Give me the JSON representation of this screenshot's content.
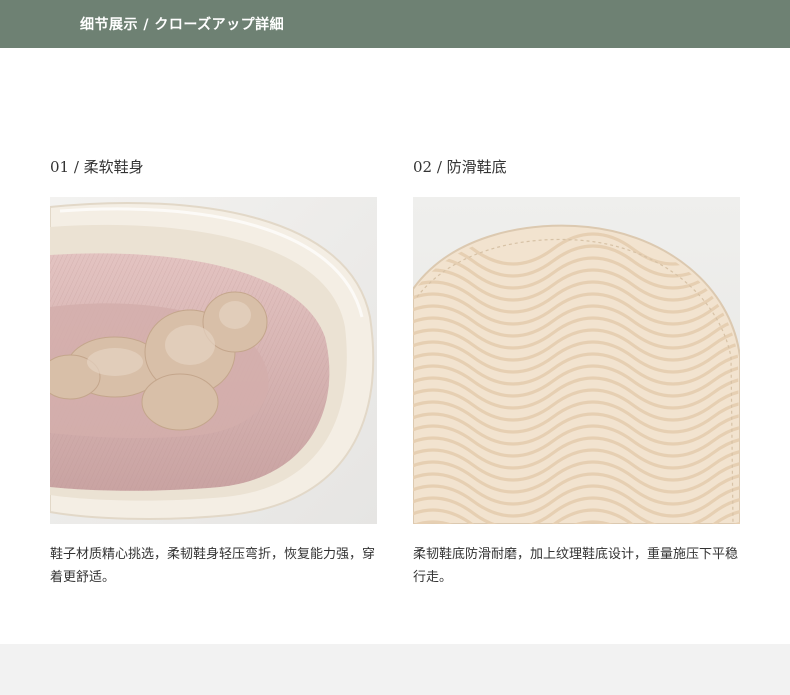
{
  "banner": {
    "title": "细节展示 / クローズアップ詳細"
  },
  "details": [
    {
      "heading": "01 / 柔软鞋身",
      "image_icon": "folded-slipper-photo",
      "description": "鞋子材质精心挑选，柔韧鞋身轻压弯折，恢复能力强，穿着更舒适。"
    },
    {
      "heading": "02 / 防滑鞋底",
      "image_icon": "wavy-sole-photo",
      "description": "柔韧鞋底防滑耐磨，加上纹理鞋底设计，重量施压下平稳行走。"
    }
  ],
  "colors": {
    "banner": "#6e8173",
    "text": "#333333",
    "footer_band": "#f2f2f2",
    "photo_bg": "#efeeec",
    "slipper_pink": "#d9b3b3",
    "fleece": "#d8bfa8",
    "sole": "#f3e6d4"
  }
}
